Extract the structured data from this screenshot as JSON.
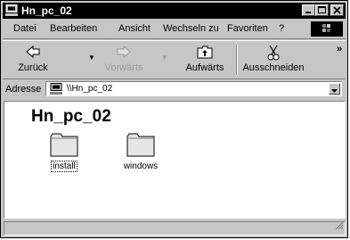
{
  "window": {
    "title": "Hn_pc_02"
  },
  "menu": [
    {
      "label": "Datei"
    },
    {
      "label": "Bearbeiten"
    },
    {
      "label": "Ansicht"
    },
    {
      "label": "Wechseln zu"
    },
    {
      "label": "Favoriten"
    },
    {
      "label": "?"
    }
  ],
  "toolbar": {
    "back_label": "Zurück",
    "forward_label": "Vorwärts",
    "up_label": "Aufwärts",
    "cut_label": "Ausschneiden",
    "more_glyph": "»"
  },
  "address": {
    "label": "Adresse",
    "value": "\\\\Hn_pc_02"
  },
  "content": {
    "heading": "Hn_pc_02",
    "folders": [
      {
        "name": "install",
        "icon": "folder-icon"
      },
      {
        "name": "windows",
        "icon": "folder-icon"
      }
    ]
  },
  "colors": {
    "titlebar": "#000000",
    "chrome": "#c6c6c6",
    "content_bg": "#ffffff"
  }
}
